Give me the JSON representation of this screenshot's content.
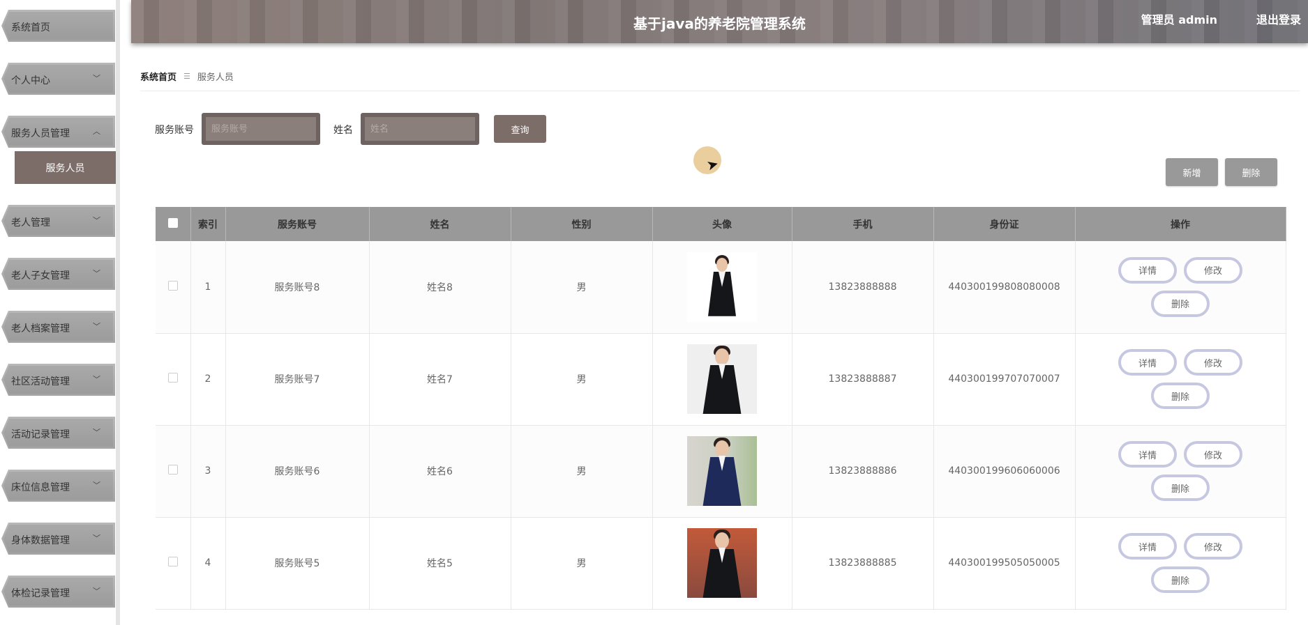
{
  "sidebar": {
    "items": [
      {
        "label": "系统首页",
        "arrow": ""
      },
      {
        "label": "个人中心",
        "arrow": "﹀"
      },
      {
        "label": "服务人员管理",
        "arrow": "︿"
      },
      {
        "label": "老人管理",
        "arrow": "﹀"
      },
      {
        "label": "老人子女管理",
        "arrow": "﹀"
      },
      {
        "label": "老人档案管理",
        "arrow": "﹀"
      },
      {
        "label": "社区活动管理",
        "arrow": "﹀"
      },
      {
        "label": "活动记录管理",
        "arrow": "﹀"
      },
      {
        "label": "床位信息管理",
        "arrow": "﹀"
      },
      {
        "label": "身体数据管理",
        "arrow": "﹀"
      },
      {
        "label": "体检记录管理",
        "arrow": "﹀"
      }
    ],
    "submenu_active": "服务人员"
  },
  "header": {
    "title": "基于java的养老院管理系统",
    "user": "管理员 admin",
    "logout": "退出登录"
  },
  "breadcrumb": {
    "home": "系统首页",
    "sep": "☰",
    "current": "服务人员"
  },
  "search": {
    "account_label": "服务账号",
    "account_placeholder": "服务账号",
    "name_label": "姓名",
    "name_placeholder": "姓名",
    "query_button": "查询"
  },
  "actions": {
    "add": "新增",
    "delete": "删除"
  },
  "table": {
    "headers": [
      "索引",
      "服务账号",
      "姓名",
      "性别",
      "头像",
      "手机",
      "身份证",
      "操作"
    ],
    "rows": [
      {
        "index": "1",
        "account": "服务账号8",
        "name": "姓名8",
        "gender": "男",
        "phone": "13823888888",
        "id_card": "440300199808080008"
      },
      {
        "index": "2",
        "account": "服务账号7",
        "name": "姓名7",
        "gender": "男",
        "phone": "13823888887",
        "id_card": "440300199707070007"
      },
      {
        "index": "3",
        "account": "服务账号6",
        "name": "姓名6",
        "gender": "男",
        "phone": "13823888886",
        "id_card": "440300199606060006"
      },
      {
        "index": "4",
        "account": "服务账号5",
        "name": "姓名5",
        "gender": "男",
        "phone": "13823888885",
        "id_card": "440300199505050005"
      }
    ],
    "op_detail": "详情",
    "op_edit": "修改",
    "op_delete": "删除"
  },
  "colors": {
    "accent": "#7d6d68",
    "button_gray": "#999999",
    "op_border": "#c5c8e0"
  }
}
